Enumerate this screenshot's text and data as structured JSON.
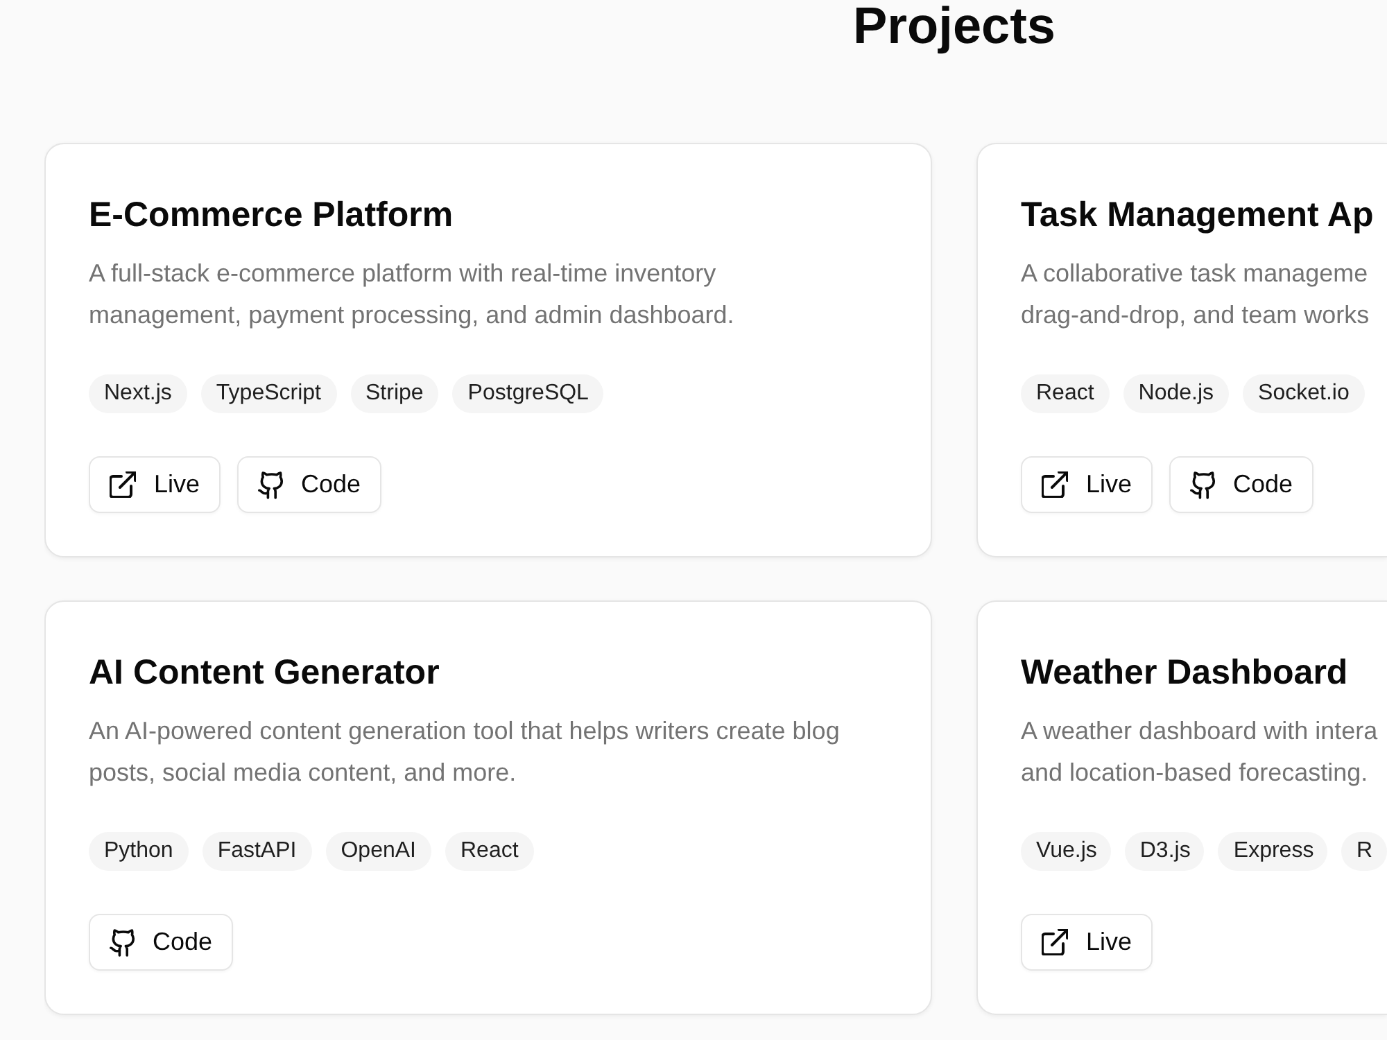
{
  "heading": "Projects",
  "projects": [
    {
      "title": "E-Commerce Platform",
      "description": [
        "A full-stack e-commerce platform with real-time inventory",
        "management, payment processing, and admin dashboard."
      ],
      "tags": [
        "Next.js",
        "TypeScript",
        "Stripe",
        "PostgreSQL"
      ],
      "links": [
        {
          "kind": "live",
          "label": "Live"
        },
        {
          "kind": "code",
          "label": "Code"
        }
      ]
    },
    {
      "title": "Task Management Ap",
      "description": [
        "A collaborative task manageme",
        "drag-and-drop, and team works"
      ],
      "tags": [
        "React",
        "Node.js",
        "Socket.io"
      ],
      "links": [
        {
          "kind": "live",
          "label": "Live"
        },
        {
          "kind": "code",
          "label": "Code"
        }
      ]
    },
    {
      "title": "AI Content Generator",
      "description": [
        "An AI-powered content generation tool that helps writers create blog",
        "posts, social media content, and more."
      ],
      "tags": [
        "Python",
        "FastAPI",
        "OpenAI",
        "React"
      ],
      "links": [
        {
          "kind": "code",
          "label": "Code"
        }
      ]
    },
    {
      "title": "Weather Dashboard",
      "description": [
        "A weather dashboard with intera",
        "and location-based forecasting."
      ],
      "tags": [
        "Vue.js",
        "D3.js",
        "Express",
        "R"
      ],
      "links": [
        {
          "kind": "live",
          "label": "Live"
        }
      ]
    }
  ]
}
